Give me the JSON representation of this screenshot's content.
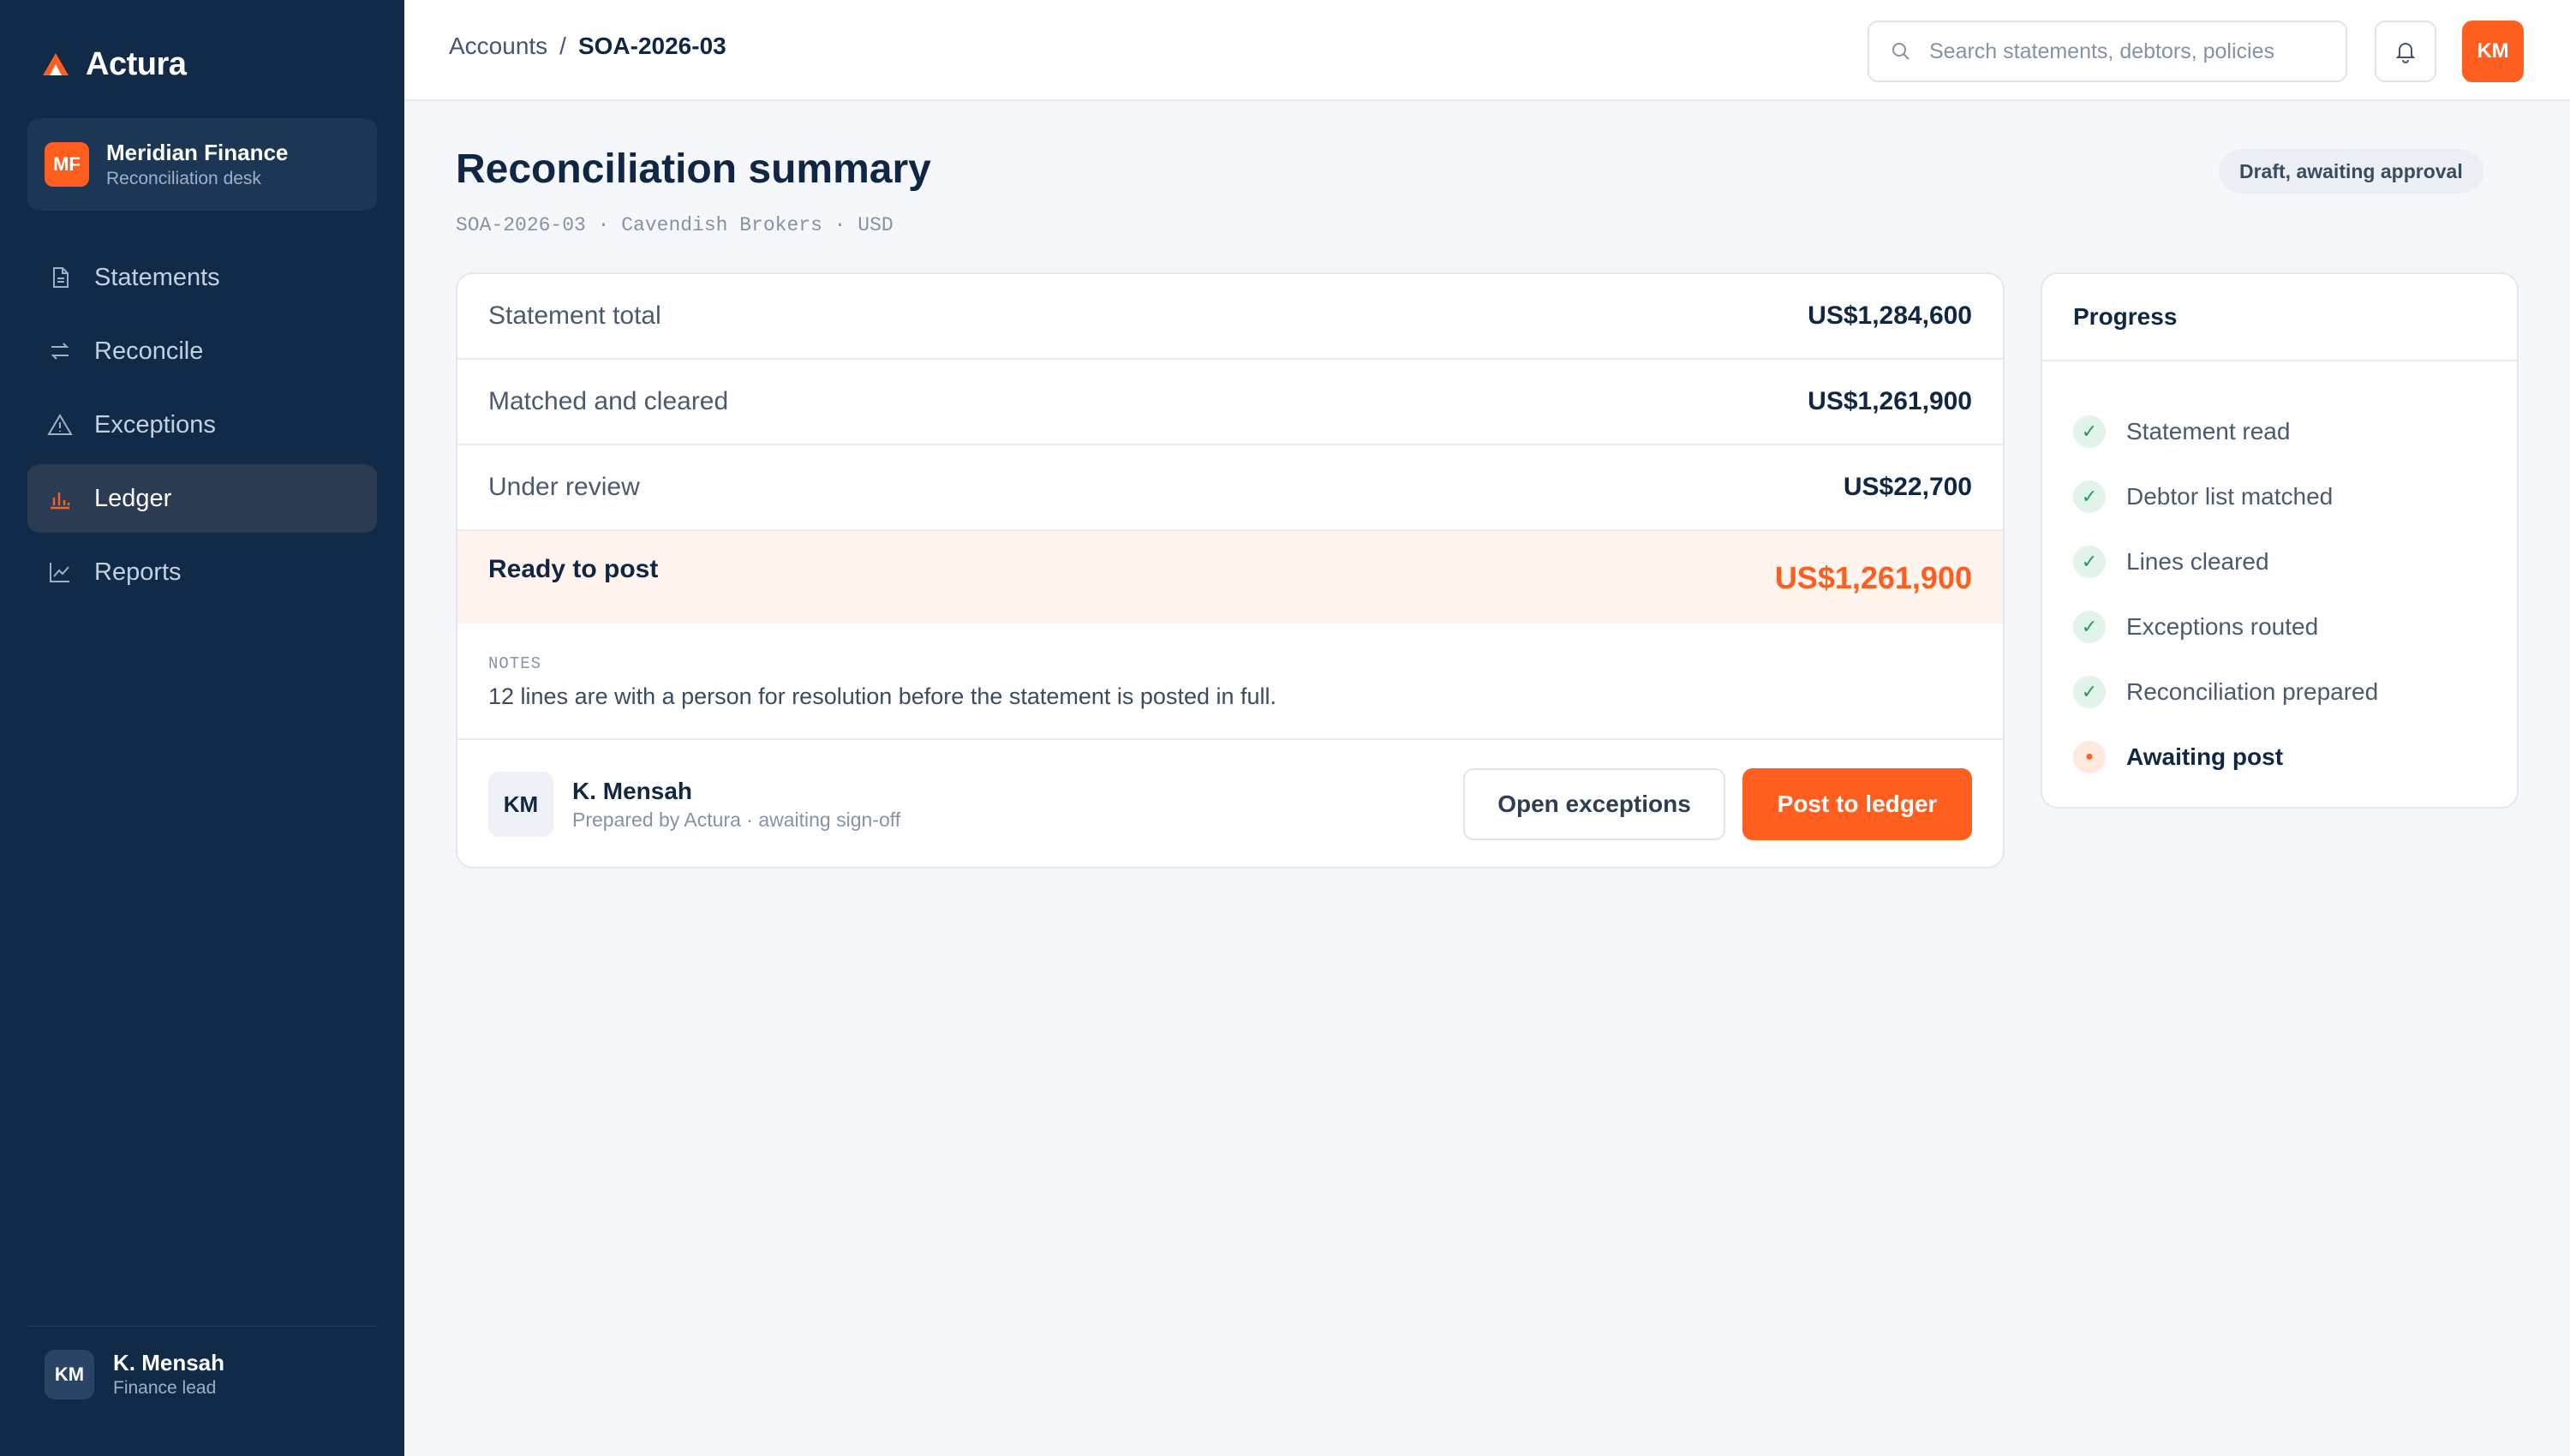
{
  "brand": {
    "name": "Actura",
    "accent": "#ff5e1f"
  },
  "org": {
    "initials": "MF",
    "name": "Meridian Finance",
    "subtitle": "Reconciliation desk"
  },
  "nav": [
    {
      "label": "Statements",
      "icon": "document-icon",
      "active": false
    },
    {
      "label": "Reconcile",
      "icon": "swap-arrows-icon",
      "active": false
    },
    {
      "label": "Exceptions",
      "icon": "warning-triangle-icon",
      "active": false
    },
    {
      "label": "Ledger",
      "icon": "bar-chart-icon",
      "active": true
    },
    {
      "label": "Reports",
      "icon": "line-chart-icon",
      "active": false
    }
  ],
  "sidebar_user": {
    "initials": "KM",
    "name": "K. Mensah",
    "role": "Finance lead"
  },
  "breadcrumb": {
    "parent": "Accounts",
    "separator": "/",
    "current": "SOA-2026-03"
  },
  "search": {
    "placeholder": "Search statements, debtors, policies"
  },
  "topbar_user": {
    "initials": "KM"
  },
  "page": {
    "title": "Reconciliation summary",
    "meta": "SOA-2026-03 · Cavendish Brokers · USD",
    "status": "Draft, awaiting approval"
  },
  "summary": {
    "rows": [
      {
        "label": "Statement total",
        "value": "US$1,284,600"
      },
      {
        "label": "Matched and cleared",
        "value": "US$1,261,900"
      },
      {
        "label": "Under review",
        "value": "US$22,700"
      }
    ],
    "ready": {
      "label": "Ready to post",
      "value": "US$1,261,900"
    },
    "notes_label": "NOTES",
    "notes_text": "12 lines are with a person for resolution before the statement is posted in full.",
    "preparer": {
      "initials": "KM",
      "name": "K. Mensah",
      "subtitle": "Prepared by Actura · awaiting sign-off"
    },
    "secondary_action": "Open exceptions",
    "primary_action": "Post to ledger"
  },
  "progress": {
    "title": "Progress",
    "steps": [
      {
        "label": "Statement read",
        "state": "done"
      },
      {
        "label": "Debtor list matched",
        "state": "done"
      },
      {
        "label": "Lines cleared",
        "state": "done"
      },
      {
        "label": "Exceptions routed",
        "state": "done"
      },
      {
        "label": "Reconciliation prepared",
        "state": "done"
      },
      {
        "label": "Awaiting post",
        "state": "current"
      }
    ]
  }
}
